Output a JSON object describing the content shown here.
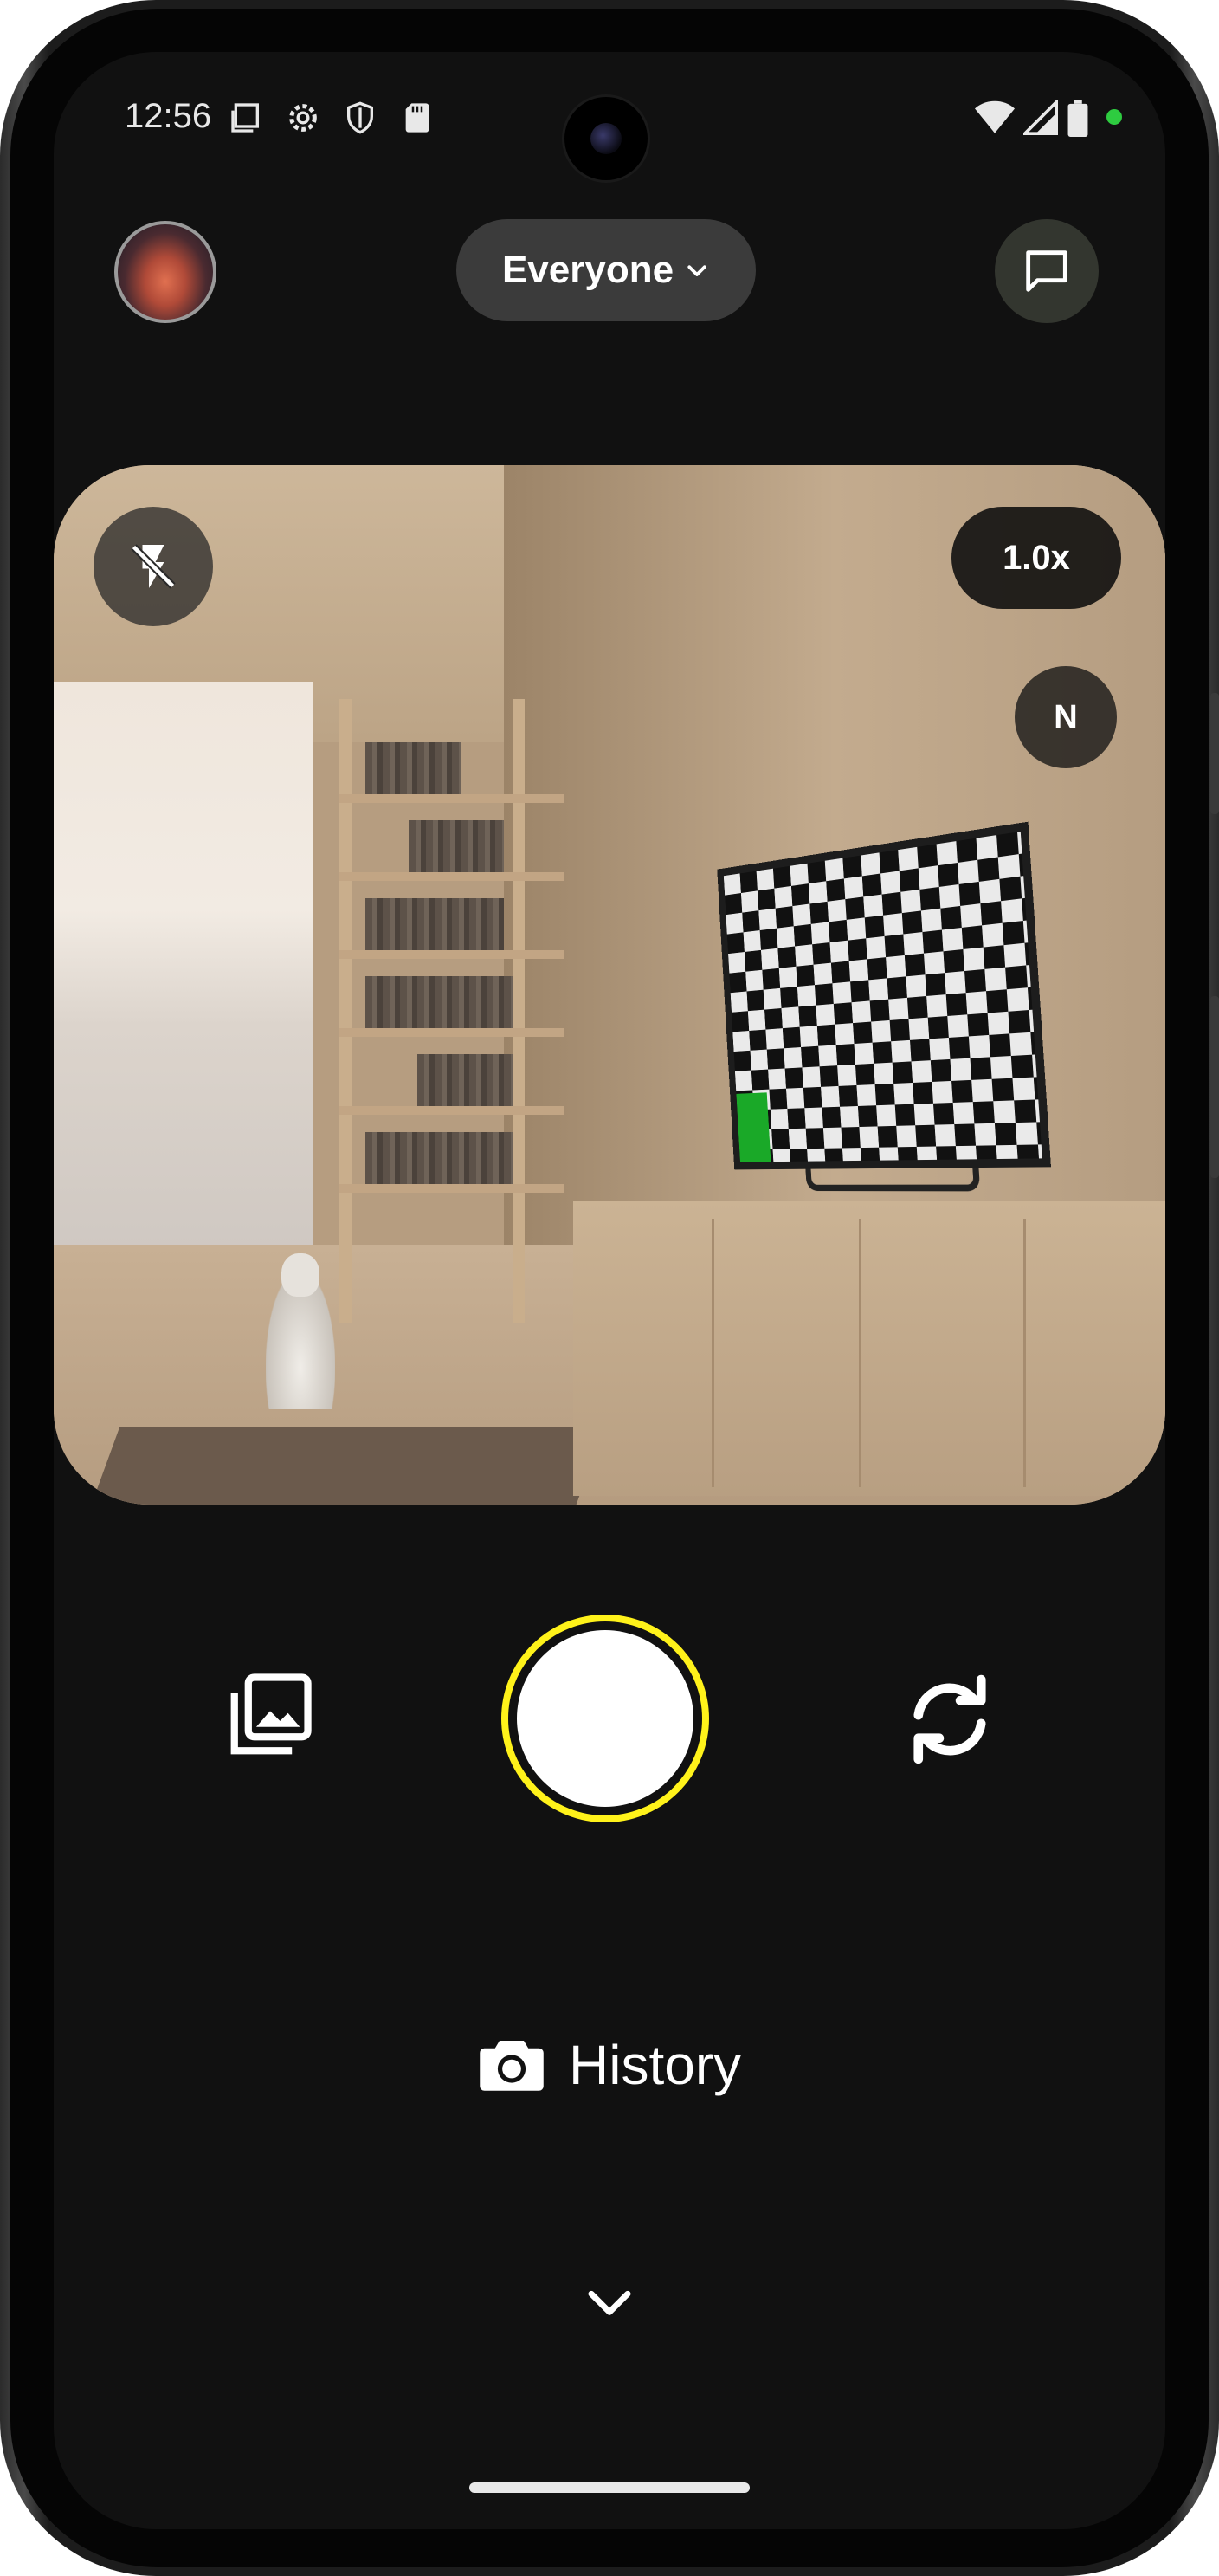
{
  "status_bar": {
    "time": "12:56",
    "icons": [
      "screenshot-icon",
      "settings-icon",
      "shield-icon",
      "sd-card-icon",
      "wifi-icon",
      "cell-signal-icon",
      "battery-icon",
      "privacy-dot-icon"
    ]
  },
  "top_bar": {
    "audience_label": "Everyone",
    "chat_icon": "chat-bubble-icon",
    "avatar_icon": "profile-avatar"
  },
  "camera": {
    "zoom_label": "1.0x",
    "mode_label": "N",
    "flash_icon": "flash-off-icon"
  },
  "controls": {
    "gallery_icon": "gallery-icon",
    "shutter": "shutter-button",
    "flip_icon": "flip-camera-icon"
  },
  "history": {
    "label": "History",
    "icon": "camera-icon"
  },
  "colors": {
    "background": "#111111",
    "shutter_ring": "#fff21a",
    "pill": "#3b3b3b",
    "chat_button": "#33362f",
    "status_dot": "#2ecc40"
  }
}
